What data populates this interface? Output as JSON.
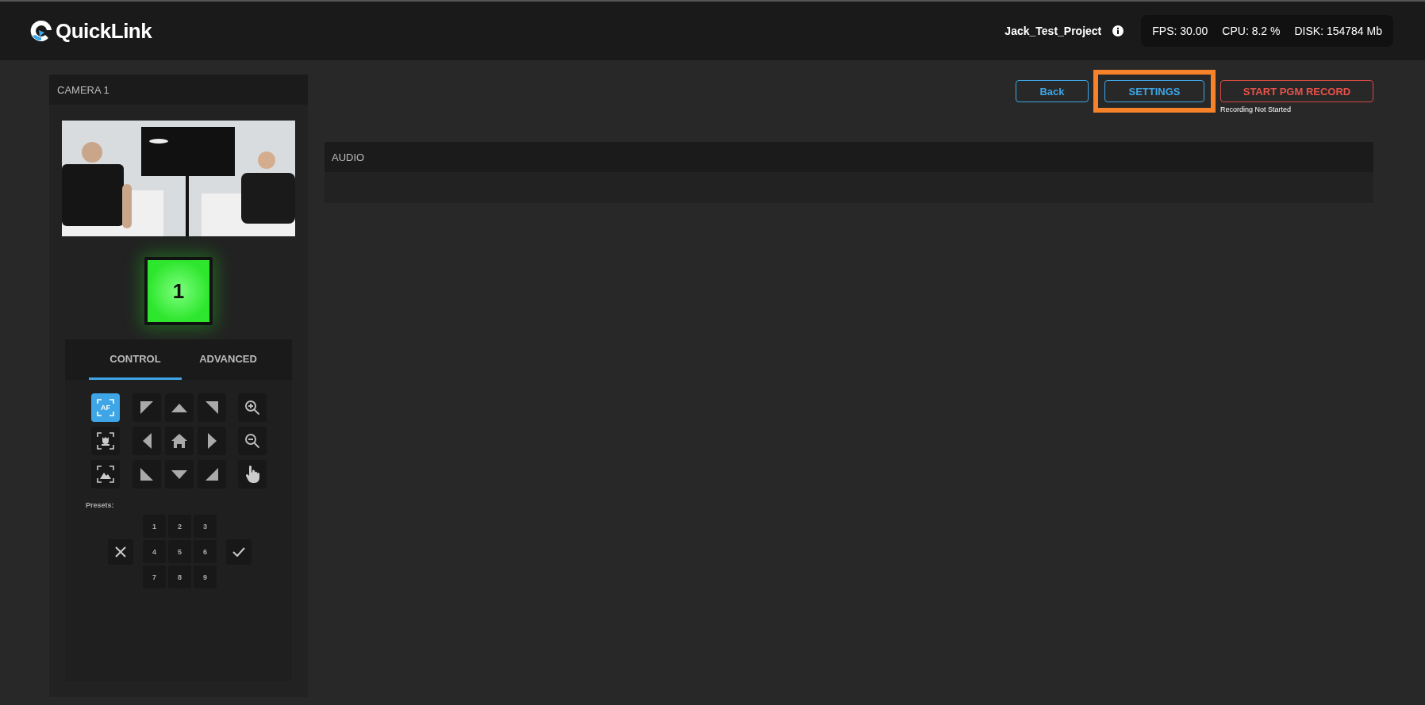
{
  "header": {
    "logo": "QuickLink",
    "project_name": "Jack_Test_Project",
    "stats": [
      {
        "label": "FPS:",
        "value": "30.00"
      },
      {
        "label": "CPU:",
        "value": "8.2 %"
      },
      {
        "label": "DISK:",
        "value": "154784 Mb"
      }
    ]
  },
  "camera_panel": {
    "title": "CAMERA 1",
    "tally": {
      "label": "1",
      "on": true
    },
    "tabs": [
      {
        "label": "CONTROL",
        "selected": true
      },
      {
        "label": "ADVANCED",
        "selected": false
      }
    ],
    "ptz_buttons": [
      {
        "kind": "autofocus",
        "label": "AF",
        "active": true
      },
      {
        "kind": "upleft"
      },
      {
        "kind": "up"
      },
      {
        "kind": "upright"
      },
      {
        "kind": "zoomin"
      },
      {
        "kind": "tracking",
        "active": false
      },
      {
        "kind": "left"
      },
      {
        "kind": "home"
      },
      {
        "kind": "right"
      },
      {
        "kind": "zoomout"
      },
      {
        "kind": "exposure",
        "active": false
      },
      {
        "kind": "downleft"
      },
      {
        "kind": "down"
      },
      {
        "kind": "downright"
      },
      {
        "kind": "touch"
      }
    ],
    "presets": {
      "label": "Presets:",
      "numbers": [
        "1",
        "2",
        "3",
        "4",
        "5",
        "6",
        "7",
        "8",
        "9"
      ]
    }
  },
  "toolbar": {
    "buttons": [
      {
        "kind": "back",
        "label": "Back",
        "highlighted": false
      },
      {
        "kind": "settings",
        "label": "SETTINGS",
        "highlighted": true
      },
      {
        "kind": "record",
        "label": "START PGM RECORD",
        "highlighted": false
      }
    ],
    "recording_status": "Recording Not Started"
  },
  "audio": {
    "title": "AUDIO"
  }
}
